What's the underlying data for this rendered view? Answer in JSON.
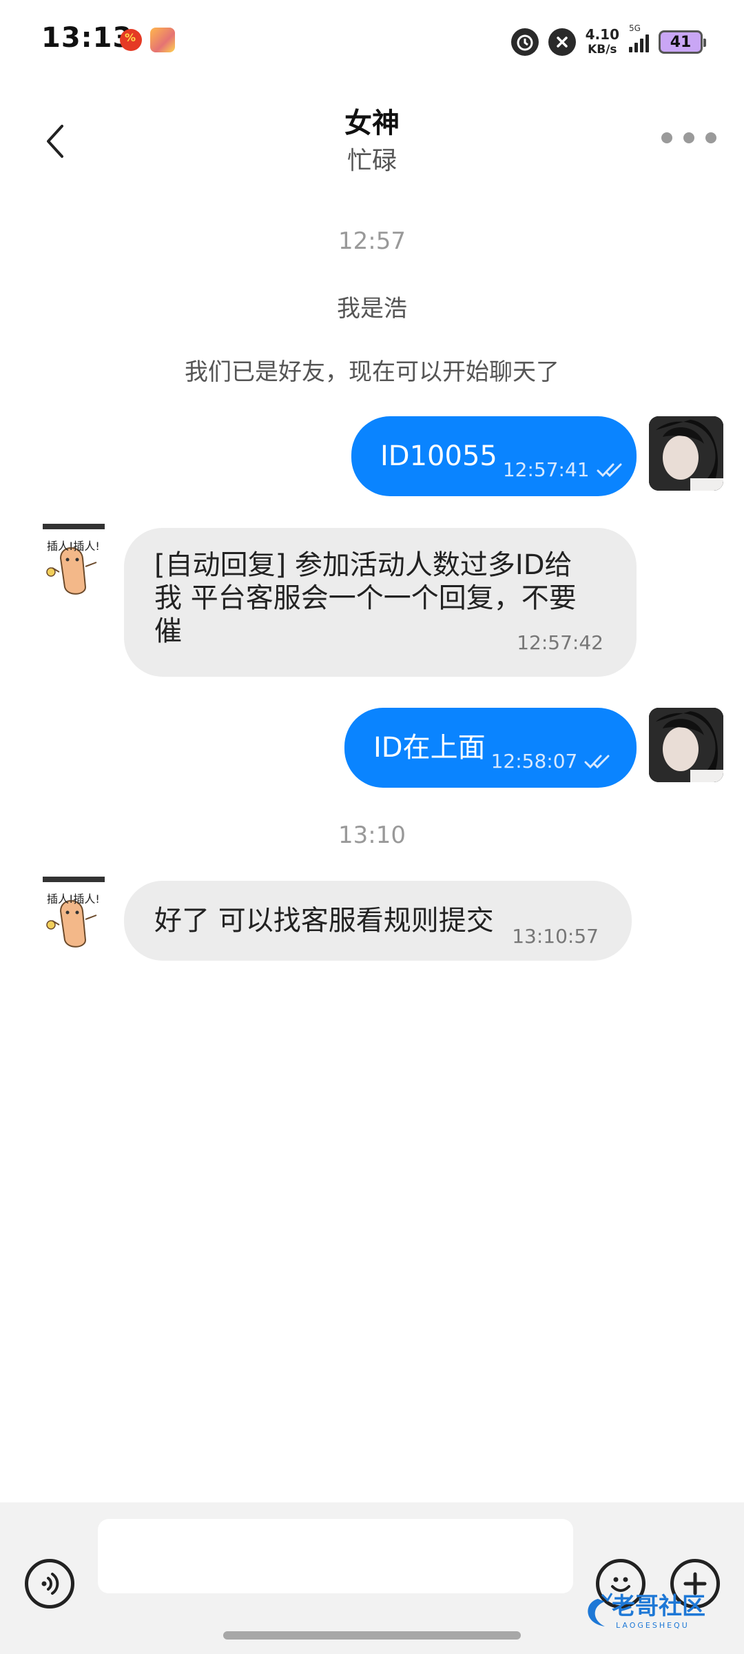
{
  "status_bar": {
    "time": "13:13",
    "net_speed_value": "4.10",
    "net_speed_unit": "KB/s",
    "network_type": "5G",
    "battery": "41",
    "icons": [
      "notification-red-icon",
      "game-app-icon",
      "alarm-icon",
      "mute-icon",
      "signal-icon",
      "battery-icon"
    ]
  },
  "header": {
    "title": "女神",
    "subtitle": "忙碌"
  },
  "chat": {
    "time_1": "12:57",
    "system_1": "我是浩",
    "system_2": "我们已是好友，现在可以开始聊天了",
    "msg_1": {
      "direction": "out",
      "text": "ID10055",
      "time": "12:57:41",
      "read": true
    },
    "msg_2": {
      "direction": "in",
      "text": "[自动回复] 参加活动人数过多ID给我  平台客服会一个一个回复，不要催",
      "line_1": "[自动回复] 参加活动人数过多ID给",
      "line_2": "我  平台客服会一个一个回复，不要",
      "line_3": "催",
      "time": "12:57:42"
    },
    "msg_3": {
      "direction": "out",
      "text": "ID在上面",
      "time": "12:58:07",
      "read": true
    },
    "time_2": "13:10",
    "msg_4": {
      "direction": "in",
      "text": "好了  可以找客服看规则提交",
      "time": "13:10:57"
    }
  },
  "input": {
    "placeholder": "",
    "value": ""
  },
  "watermark": {
    "text": "老哥社区",
    "subtext": "LAOGESHEQU"
  },
  "colors": {
    "outgoing_bubble": "#0a84ff",
    "incoming_bubble": "#ececec",
    "background": "#ffffff",
    "input_bar": "#f2f2f2"
  }
}
